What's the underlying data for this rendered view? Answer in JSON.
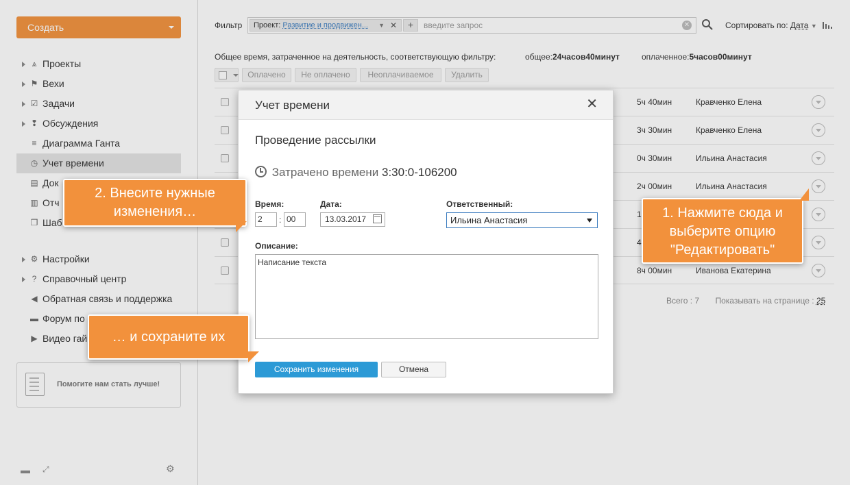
{
  "sidebar": {
    "create_label": "Создать",
    "nav_main": [
      {
        "label": "Проекты",
        "icon": "projects-icon",
        "glyph": "⩓",
        "arrow": true,
        "active": false
      },
      {
        "label": "Вехи",
        "icon": "flag-icon",
        "glyph": "⚑",
        "arrow": true,
        "active": false
      },
      {
        "label": "Задачи",
        "icon": "tasks-icon",
        "glyph": "☑",
        "arrow": true,
        "active": false
      },
      {
        "label": "Обсуждения",
        "icon": "discussions-icon",
        "glyph": "❢",
        "arrow": true,
        "active": false
      },
      {
        "label": "Диаграмма Ганта",
        "icon": "gantt-icon",
        "glyph": "≡",
        "arrow": false,
        "active": false
      },
      {
        "label": "Учет времени",
        "icon": "clock-icon",
        "glyph": "◷",
        "arrow": false,
        "active": true
      },
      {
        "label": "Док",
        "icon": "documents-icon",
        "glyph": "▤",
        "arrow": false,
        "active": false
      },
      {
        "label": "Отч",
        "icon": "reports-icon",
        "glyph": "▥",
        "arrow": false,
        "active": false
      },
      {
        "label": "Шаб",
        "icon": "templates-icon",
        "glyph": "❐",
        "arrow": false,
        "active": false
      }
    ],
    "nav_settings": [
      {
        "label": "Настройки",
        "icon": "gear-icon",
        "glyph": "⚙",
        "arrow": true
      },
      {
        "label": "Справочный центр",
        "icon": "help-icon",
        "glyph": "?",
        "arrow": true
      },
      {
        "label": "Обратная связь и поддержка",
        "icon": "megaphone-icon",
        "glyph": "◀",
        "arrow": false
      },
      {
        "label": "Форум по",
        "icon": "forum-icon",
        "glyph": "▬",
        "arrow": false
      },
      {
        "label": "Видео гай",
        "icon": "video-icon",
        "glyph": "▶",
        "arrow": false
      }
    ],
    "help_text": "Помогите нам стать лучше!"
  },
  "filter": {
    "label": "Фильтр",
    "chip_key": "Проект:",
    "chip_value": "Развитие и продвижен...",
    "placeholder": "введите запрос"
  },
  "sort": {
    "label": "Сортировать по:",
    "value": "Дата"
  },
  "totals": {
    "description": "Общее время, затраченное на деятельность, соответствующую фильтру:",
    "total_label": "общее:",
    "total_value": "24часов40минут",
    "paid_label": "оплаченное:",
    "paid_value": "5часов00минут"
  },
  "toolbar": {
    "paid": "Оплачено",
    "unpaid": "Не оплачено",
    "nonbillable": "Неоплачиваемое",
    "delete": "Удалить"
  },
  "rows": [
    {
      "duration": "5ч 40мин",
      "person": "Кравченко Елена"
    },
    {
      "duration": "3ч 30мин",
      "person": "Кравченко Елена"
    },
    {
      "duration": "0ч 30мин",
      "person": "Ильина Анастасия"
    },
    {
      "duration": "2ч 00мин",
      "person": "Ильина Анастасия"
    },
    {
      "duration": "1",
      "person": ""
    },
    {
      "duration": "4",
      "person": ""
    },
    {
      "duration": "8ч 00мин",
      "person": "Иванова Екатерина"
    }
  ],
  "pager": {
    "total_label": "Всего : 7",
    "per_page_label": "Показывать на странице :",
    "per_page_value": "25"
  },
  "dialog": {
    "title": "Учет времени",
    "task_name": "Проведение рассылки",
    "spent_label": "Затрачено времени",
    "spent_value": "3:30:0-106200",
    "time_label": "Время:",
    "hours": "2",
    "minutes": "00",
    "date_label": "Дата:",
    "date_value": "13.03.2017",
    "responsible_label": "Ответственный:",
    "responsible_value": "Ильина Анастасия",
    "description_label": "Описание:",
    "description_value": "Написание текста",
    "save_label": "Сохранить изменения",
    "cancel_label": "Отмена"
  },
  "callouts": {
    "step1": "1. Нажмите сюда и выберите опцию \"Редактировать\"",
    "step2": "2. Внесите нужные изменения…",
    "step3": "… и сохраните их"
  },
  "colors": {
    "accent": "#f2913c",
    "primary_button": "#2c9ad6",
    "link": "#3b7cbf"
  }
}
